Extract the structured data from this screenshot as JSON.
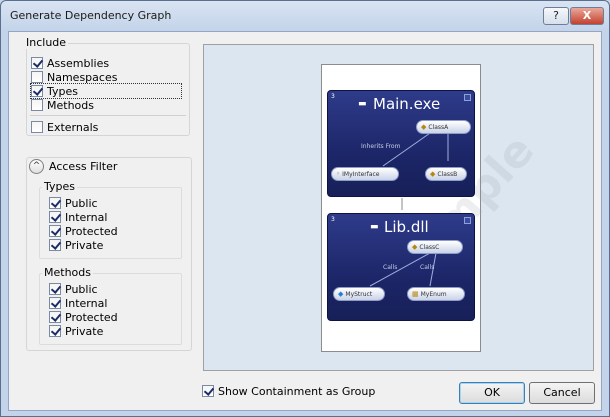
{
  "window": {
    "title": "Generate Dependency Graph",
    "help_glyph": "?",
    "close_glyph": "X"
  },
  "include": {
    "label": "Include",
    "items": [
      {
        "label": "Assemblies",
        "checked": true
      },
      {
        "label": "Namespaces",
        "checked": false
      },
      {
        "label": "Types",
        "checked": true
      },
      {
        "label": "Methods",
        "checked": false
      }
    ],
    "externals": {
      "label": "Externals",
      "checked": false
    }
  },
  "access_filter": {
    "label": "Access Filter",
    "types": {
      "label": "Types",
      "items": [
        {
          "label": "Public",
          "checked": true
        },
        {
          "label": "Internal",
          "checked": true
        },
        {
          "label": "Protected",
          "checked": true
        },
        {
          "label": "Private",
          "checked": true
        }
      ]
    },
    "methods": {
      "label": "Methods",
      "items": [
        {
          "label": "Public",
          "checked": true
        },
        {
          "label": "Internal",
          "checked": true
        },
        {
          "label": "Protected",
          "checked": true
        },
        {
          "label": "Private",
          "checked": true
        }
      ]
    }
  },
  "preview": {
    "watermark": "Sample",
    "main": {
      "number": "3",
      "title": "Main.exe",
      "class_a": "ClassA",
      "interface": "IMyInterface",
      "class_b": "ClassB",
      "edge_label": "Inherits From"
    },
    "lib": {
      "number": "3",
      "title": "Lib.dll",
      "class_c": "ClassC",
      "struct": "MyStruct",
      "enum": "MyEnum",
      "edge_label_1": "Calls",
      "edge_label_2": "Calls"
    }
  },
  "footer": {
    "show_containment": {
      "label": "Show Containment as Group",
      "checked": true
    },
    "ok_label": "OK",
    "cancel_label": "Cancel"
  }
}
